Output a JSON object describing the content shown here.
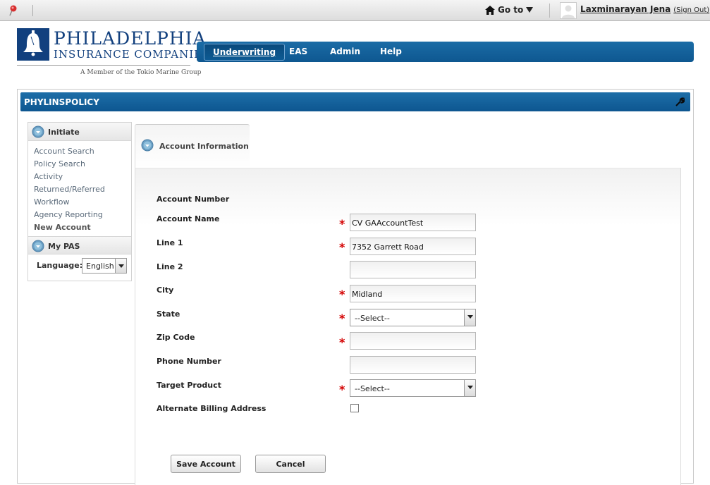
{
  "topbar": {
    "goto_label": "Go to",
    "user_name": "Laxminarayan Jena",
    "sign_out": "(Sign Out)"
  },
  "logo": {
    "name_line1": "PHILADELPHIA",
    "name_line2": "INSURANCE COMPANIES",
    "member_text": "A Member of the Tokio Marine Group"
  },
  "nav": {
    "items": [
      "Underwriting",
      "EAS",
      "Admin",
      "Help"
    ],
    "active": "Underwriting"
  },
  "page": {
    "title": "PHYLINSPOLICY"
  },
  "sidebar": {
    "initiate_label": "Initiate",
    "links": [
      "Account Search",
      "Policy Search",
      "Activity",
      "Returned/Referred",
      "Workflow",
      "Agency Reporting",
      "New Account"
    ],
    "current_link": "New Account",
    "mypas_label": "My PAS",
    "language_label": "Language:",
    "language_value": "English"
  },
  "tab": {
    "label": "Account Information"
  },
  "form": {
    "account_number_label": "Account Number",
    "account_name_label": "Account Name",
    "account_name_value": "CV GAAccountTest",
    "line1_label": "Line 1",
    "line1_value": "7352 Garrett Road",
    "line2_label": "Line 2",
    "line2_value": "",
    "city_label": "City",
    "city_value": "Midland",
    "state_label": "State",
    "state_value": "--Select--",
    "zip_label": "Zip Code",
    "zip_value": "",
    "phone_label": "Phone Number",
    "phone_value": "",
    "target_product_label": "Target Product",
    "target_product_value": "--Select--",
    "alt_billing_label": "Alternate Billing Address",
    "alt_billing_checked": false,
    "required_marker": "*"
  },
  "buttons": {
    "save": "Save Account",
    "cancel": "Cancel"
  },
  "colors": {
    "brand_blue": "#12407e",
    "nav_blue": "#0e5790",
    "required_red": "#d40000"
  }
}
